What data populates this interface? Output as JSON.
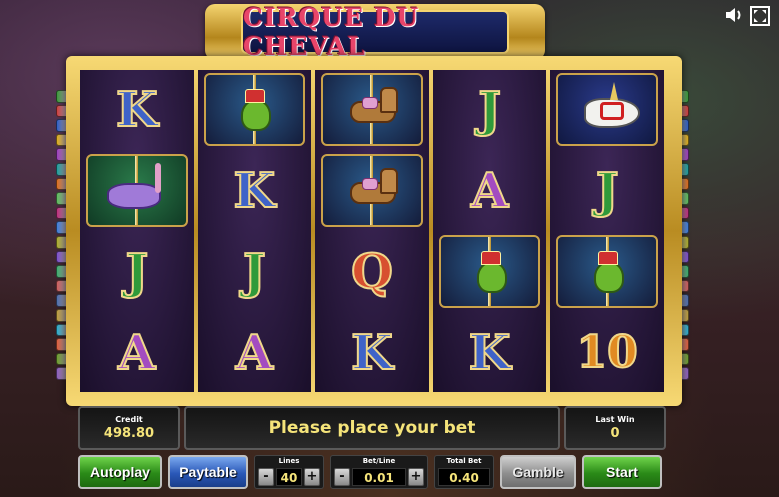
{
  "game": {
    "title": "CIRQUE DU CHEVAL"
  },
  "icons": {
    "sound": "speaker-icon",
    "fullscreen": "fullscreen-icon"
  },
  "reels": [
    [
      "K",
      "ostrich",
      "J",
      "A"
    ],
    [
      "frog",
      "K",
      "J",
      "A"
    ],
    [
      "horse",
      "horse",
      "Q",
      "K"
    ],
    [
      "J",
      "A",
      "frog",
      "K"
    ],
    [
      "unicorn",
      "J",
      "frog",
      "10"
    ]
  ],
  "panel": {
    "credit_label": "Credit",
    "credit_value": "498.80",
    "message": "Please place your bet",
    "last_win_label": "Last Win",
    "last_win_value": "0"
  },
  "controls": {
    "autoplay": "Autoplay",
    "paytable": "Paytable",
    "lines_label": "Lines",
    "lines_value": "40",
    "betline_label": "Bet/Line",
    "betline_value": "0.01",
    "totalbet_label": "Total Bet",
    "totalbet_value": "0.40",
    "gamble": "Gamble",
    "start": "Start",
    "minus": "-",
    "plus": "+"
  },
  "colors": {
    "line_indicators": [
      "#3b9b3b",
      "#d04040",
      "#3060c8",
      "#e0b020",
      "#a040c0",
      "#20a0a0",
      "#e07020",
      "#60c060",
      "#c03080",
      "#4080e0",
      "#b0b030",
      "#8050d0",
      "#40b070",
      "#d06060",
      "#5070b0",
      "#c0a040",
      "#30b0d0",
      "#e06040",
      "#70a030",
      "#9060c0"
    ]
  }
}
